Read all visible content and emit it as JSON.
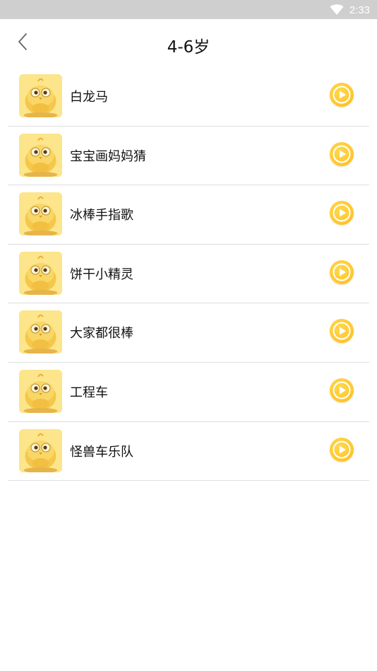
{
  "status_bar": {
    "time": "2:33",
    "wifi_icon": "wifi-icon"
  },
  "header": {
    "title": "4-6岁",
    "back_icon": "chevron-left-icon"
  },
  "songs": [
    {
      "title": "白龙马"
    },
    {
      "title": "宝宝画妈妈猜"
    },
    {
      "title": "冰棒手指歌"
    },
    {
      "title": "饼干小精灵"
    },
    {
      "title": "大家都很棒"
    },
    {
      "title": "工程车"
    },
    {
      "title": "怪兽车乐队"
    }
  ],
  "colors": {
    "status_bar": "#cfcfcf",
    "accent": "#ffc933",
    "divider": "#dedede",
    "thumb_bg": "#fbe07a"
  }
}
